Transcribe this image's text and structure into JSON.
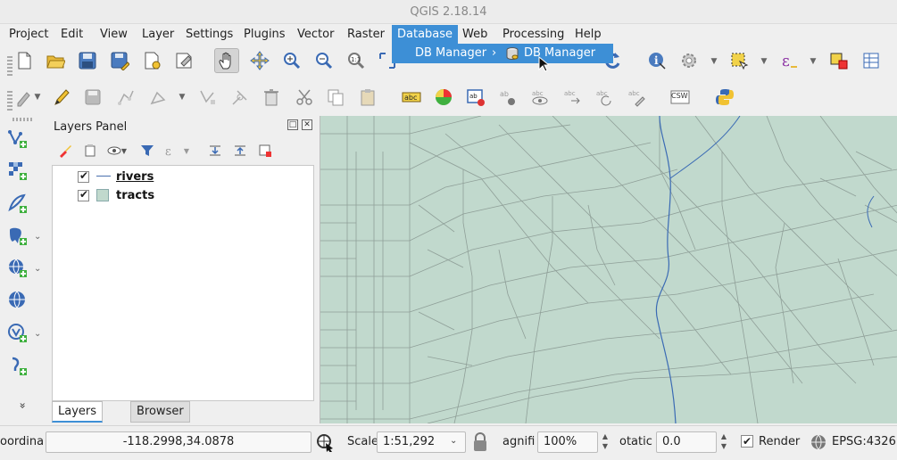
{
  "window": {
    "title": "QGIS 2.18.14"
  },
  "menubar": {
    "items": [
      "Project",
      "Edit",
      "View",
      "Layer",
      "Settings",
      "Plugins",
      "Vector",
      "Raster",
      "Database",
      "Web",
      "Processing",
      "Help"
    ],
    "open_item": "Database"
  },
  "database_menu": {
    "item_label": "DB Manager",
    "submenu_item_label": "DB Manager",
    "submenu_icon": "db-manager-icon"
  },
  "toolbar_top": {
    "icons": [
      "new-project-icon",
      "open-project-icon",
      "save-project-icon",
      "save-as-icon",
      "new-print-composer-icon",
      "composer-manager-icon",
      "pan-icon",
      "pan-to-selection-icon",
      "zoom-in-icon",
      "zoom-out-icon",
      "zoom-native-icon",
      "identify-icon",
      "run-feature-action-icon",
      "select-features-icon",
      "field-calculator-icon",
      "deselect-all-icon",
      "attribute-table-icon"
    ]
  },
  "toolbar_bottom": {
    "icons": [
      "edits-icon",
      "toggle-editing-icon",
      "save-layer-edits-icon",
      "add-feature-icon",
      "move-feature-icon",
      "node-tool-icon",
      "delete-selected-icon",
      "cut-features-icon",
      "copy-features-icon",
      "paste-features-icon",
      "label-abc-icon",
      "layer-labeling-icon",
      "pin-labels-icon",
      "highlight-pinned-icon",
      "show-hide-labels-icon",
      "move-label-icon",
      "rotate-label-icon",
      "change-label-icon",
      "csw-icon",
      "python-console-icon"
    ],
    "csw_label": "CSW"
  },
  "left_toolbar": {
    "icons": [
      "add-vector-layer-icon",
      "add-raster-layer-icon",
      "add-delimited-text-icon",
      "add-postgis-layer-icon",
      "add-wms-layer-icon",
      "add-wfs-layer-icon",
      "add-virtual-layer-icon",
      "add-feature-tool-icon"
    ],
    "expand_label": "»"
  },
  "layers_panel": {
    "title": "Layers Panel",
    "tool_icons": [
      "style-icon",
      "add-group-icon",
      "visibility-icon",
      "filter-icon",
      "expression-filter-icon",
      "expand-all-icon",
      "collapse-all-icon",
      "remove-layer-icon"
    ],
    "layers": [
      {
        "name": "rivers",
        "checked": true,
        "symbol": "line",
        "color": "#4a6fae",
        "selected": true
      },
      {
        "name": "tracts",
        "checked": true,
        "symbol": "polygon",
        "color": "#c1d9cd",
        "selected": false
      }
    ],
    "tabs": [
      {
        "label": "Layers Panel",
        "active": true
      },
      {
        "label": "Browser Panel",
        "active": false
      }
    ]
  },
  "map": {
    "background": "#c1d9cd",
    "boundary_color": "#8f9f98",
    "river_color": "#3a6ab4"
  },
  "statusbar": {
    "coordinate_label": "oordina",
    "coordinate_value": "-118.2998,34.0878",
    "scale_label": "Scale",
    "scale_value": "1:51,292",
    "magnifier_label": "agnifi",
    "magnifier_value": "100%",
    "rotation_label": "otatic",
    "rotation_value": "0.0",
    "render_label": "Render",
    "render_checked": true,
    "crs_label": "EPSG:4326"
  },
  "colors": {
    "accent": "#3d8fd6",
    "chrome": "#efefef"
  }
}
